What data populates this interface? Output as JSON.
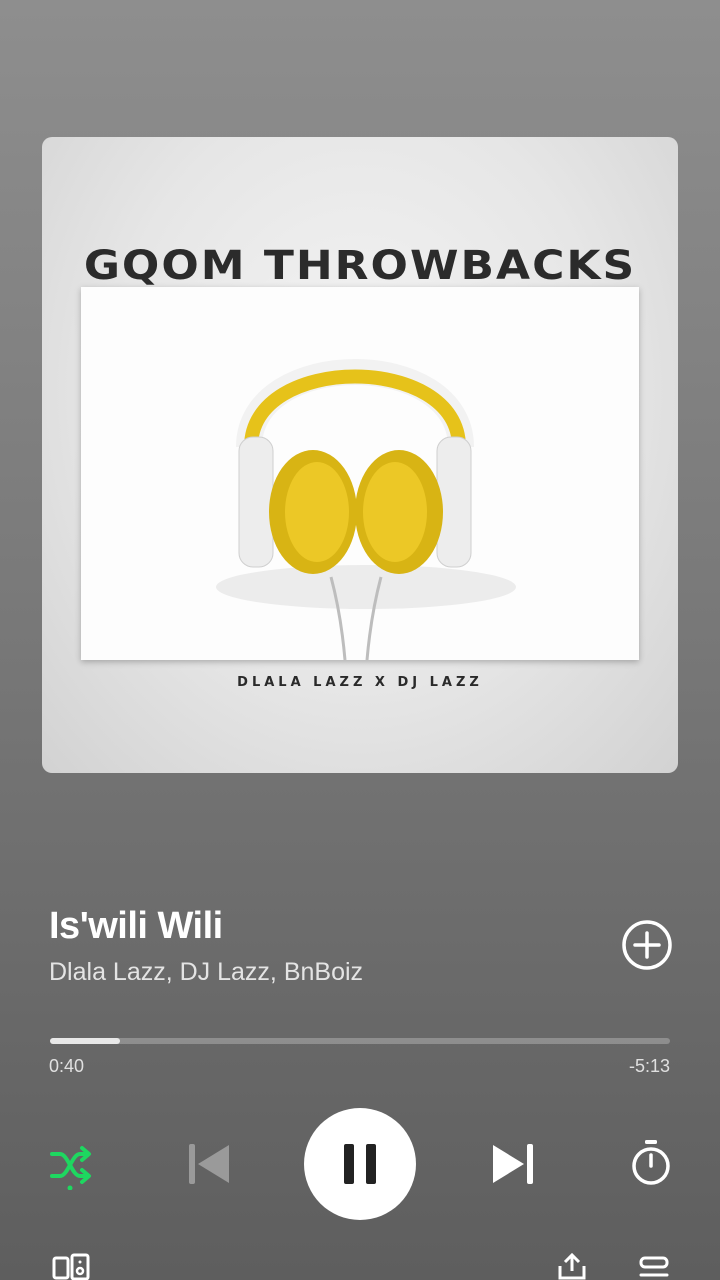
{
  "album_art": {
    "title": "GQOM THROWBACKS",
    "credit": "DLALA LAZZ X DJ LAZZ"
  },
  "track": {
    "title": "Is'wili Wili",
    "artists": "Dlala Lazz, DJ Lazz, BnBoiz"
  },
  "playback": {
    "elapsed": "0:40",
    "remaining": "-5:13",
    "progress_fraction": 0.113,
    "state": "playing",
    "shuffle_on": true
  },
  "icons": {
    "add": "plus-circle-icon",
    "shuffle": "shuffle-icon",
    "previous": "skip-previous-icon",
    "pause": "pause-icon",
    "next": "skip-next-icon",
    "sleep_timer": "timer-icon",
    "devices": "devices-icon",
    "share": "share-icon",
    "queue": "queue-icon"
  },
  "colors": {
    "accent": "#1ed760",
    "text": "#ffffff"
  }
}
